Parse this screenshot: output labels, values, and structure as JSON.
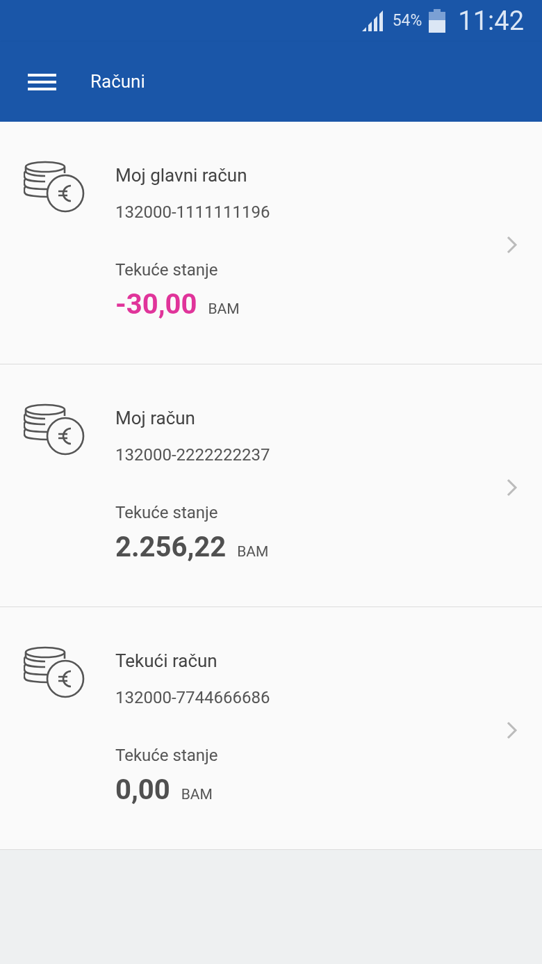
{
  "status_bar": {
    "battery": "54%",
    "time": "11:42"
  },
  "app_bar": {
    "title": "Računi"
  },
  "accounts": [
    {
      "name": "Moj glavni račun",
      "number": "132000-1111111196",
      "balance_label": "Tekuće stanje",
      "amount": "-30,00",
      "currency": "BAM",
      "negative": true
    },
    {
      "name": "Moj račun",
      "number": "132000-2222222237",
      "balance_label": "Tekuće stanje",
      "amount": "2.256,22",
      "currency": "BAM",
      "negative": false
    },
    {
      "name": "Tekući račun",
      "number": "132000-7744666686",
      "balance_label": "Tekuće stanje",
      "amount": "0,00",
      "currency": "BAM",
      "negative": false
    }
  ]
}
